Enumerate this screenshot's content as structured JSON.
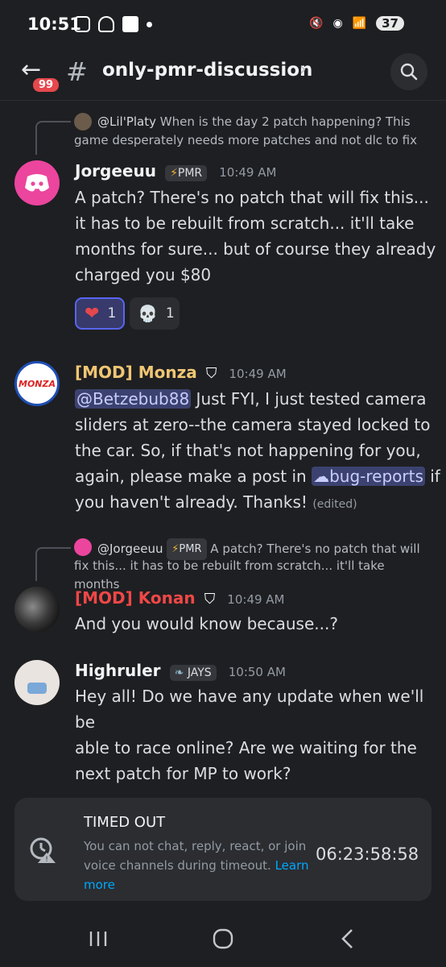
{
  "status": {
    "time": "10:51",
    "battery": "37",
    "net": "6E"
  },
  "header": {
    "badge": "99",
    "channel": "only-pmr-discussion"
  },
  "messages": [
    {
      "reply": {
        "author": "@Lil'Platy",
        "text_line1": "When is the day 2 patch happening? This",
        "text_line2": "game desperately needs more patches and not dlc to fix"
      },
      "author": "Jorgeeuu",
      "tag": "PMR",
      "time": "10:49 AM",
      "lines": [
        "A patch? There's no patch that will fix this...",
        "it has to be rebuilt from scratch... it'll take",
        "months for sure... but of course they already",
        "charged you $80"
      ],
      "reactions": [
        {
          "icon": "heart-emoji",
          "count": "1"
        },
        {
          "icon": "skull-emoji",
          "count": "1"
        }
      ]
    },
    {
      "author": "[MOD] Monza",
      "time": "10:49 AM",
      "mention": "@Betzebub88",
      "line1_rest": "Just FYI, I just tested camera",
      "line2": "sliders at zero--the camera stayed locked to",
      "line3": "the car. So, if that's not happening for you,",
      "line4_pre": "again, please make a post in",
      "channel_link": "bug-reports",
      "line4_post": "if",
      "line5": "you haven't already. Thanks!",
      "edited": "(edited)",
      "avatar_text": "MONZA"
    },
    {
      "reply": {
        "author": "@Jorgeeuu",
        "tag": "PMR",
        "text_line1": "A patch? There's no patch that will",
        "text_line2": "fix this... it has to be rebuilt from scratch... it'll take months"
      },
      "author": "[MOD] Konan",
      "time": "10:49 AM",
      "lines": [
        "And you would know because...?"
      ]
    },
    {
      "author": "Highruler",
      "tag": "JAYS",
      "time": "10:50 AM",
      "lines": [
        "Hey all! Do we have any update when we'll be",
        "able to race online? Are we waiting for the",
        "next patch for MP to work?"
      ]
    }
  ],
  "timeout": {
    "title": "TIMED OUT",
    "desc": "You can not chat, reply, react, or join voice channels during timeout.",
    "link": "Learn more",
    "timer": "06:23:58:58"
  },
  "colors": {
    "background": "#1e1f22",
    "mod_monza": "#f0c674",
    "mod_konan": "#f04747",
    "blurple": "#5865f2",
    "discord_pink": "#eb459e"
  }
}
